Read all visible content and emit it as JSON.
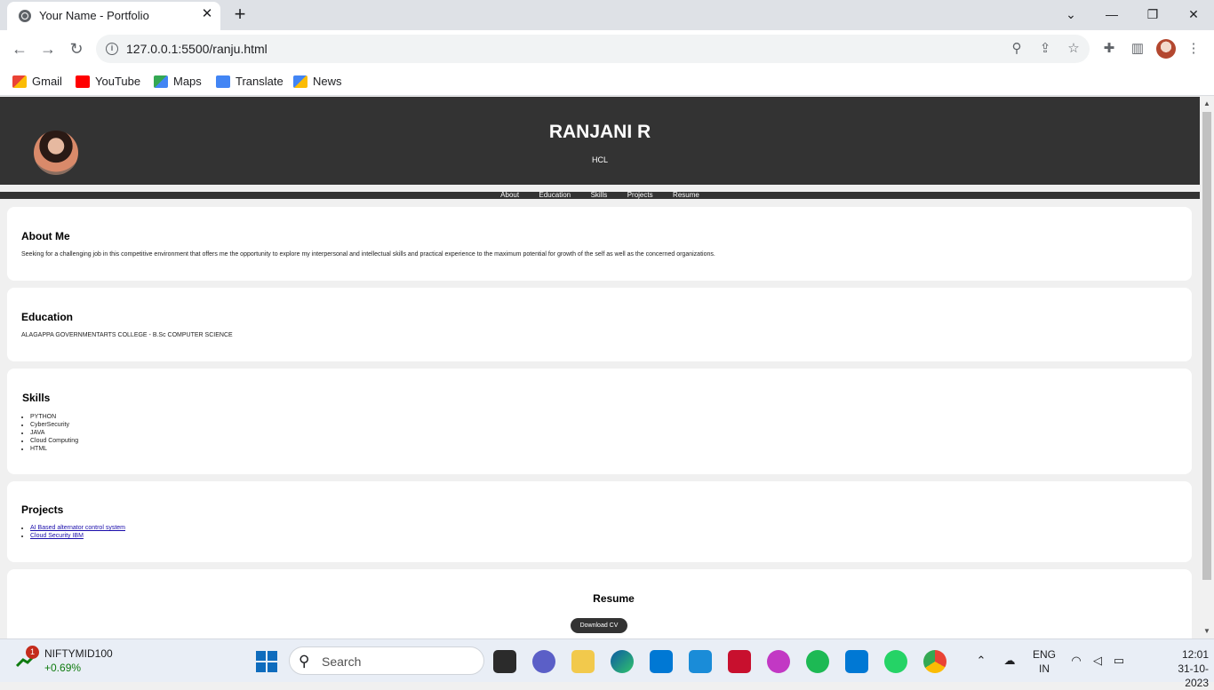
{
  "browser": {
    "tab_title": "Your Name - Portfolio",
    "url": "127.0.0.1:5500/ranju.html",
    "bookmarks": [
      "Gmail",
      "YouTube",
      "Maps",
      "Translate",
      "News"
    ]
  },
  "header": {
    "name": "RANJANI R",
    "subtitle": "HCL"
  },
  "nav": [
    "About",
    "Education",
    "Skills",
    "Projects",
    "Resume"
  ],
  "about": {
    "title": "About Me",
    "text": "Seeking for a challenging job in this competitive environment that offers me the opportunity to explore my interpersonal and intellectual skills and practical experience to the maximum potential for growth of the self as well as the concerned organizations."
  },
  "education": {
    "title": "Education",
    "text": "ALAGAPPA GOVERNMENTARTS COLLEGE - B.Sc COMPUTER SCIENCE"
  },
  "skills": {
    "title": "Skills",
    "items": [
      "PYTHON",
      "CyberSecurity",
      "JAVA",
      "Cloud Computing",
      "HTML"
    ]
  },
  "projects": {
    "title": "Projects",
    "items": [
      "AI Based alternator control system",
      "Cloud Security IBM"
    ]
  },
  "resume": {
    "title": "Resume",
    "button": "Download CV"
  },
  "taskbar": {
    "stock_name": "NIFTYMID100",
    "stock_change": "+0.69%",
    "stock_badge": "1",
    "search_placeholder": "Search",
    "lang_line1": "ENG",
    "lang_line2": "IN",
    "time": "12:01",
    "date": "31-10-2023"
  },
  "colors": {
    "header_bg": "#333333",
    "page_bg": "#f0f0f0",
    "card_bg": "#ffffff",
    "link": "#1a0dab"
  }
}
